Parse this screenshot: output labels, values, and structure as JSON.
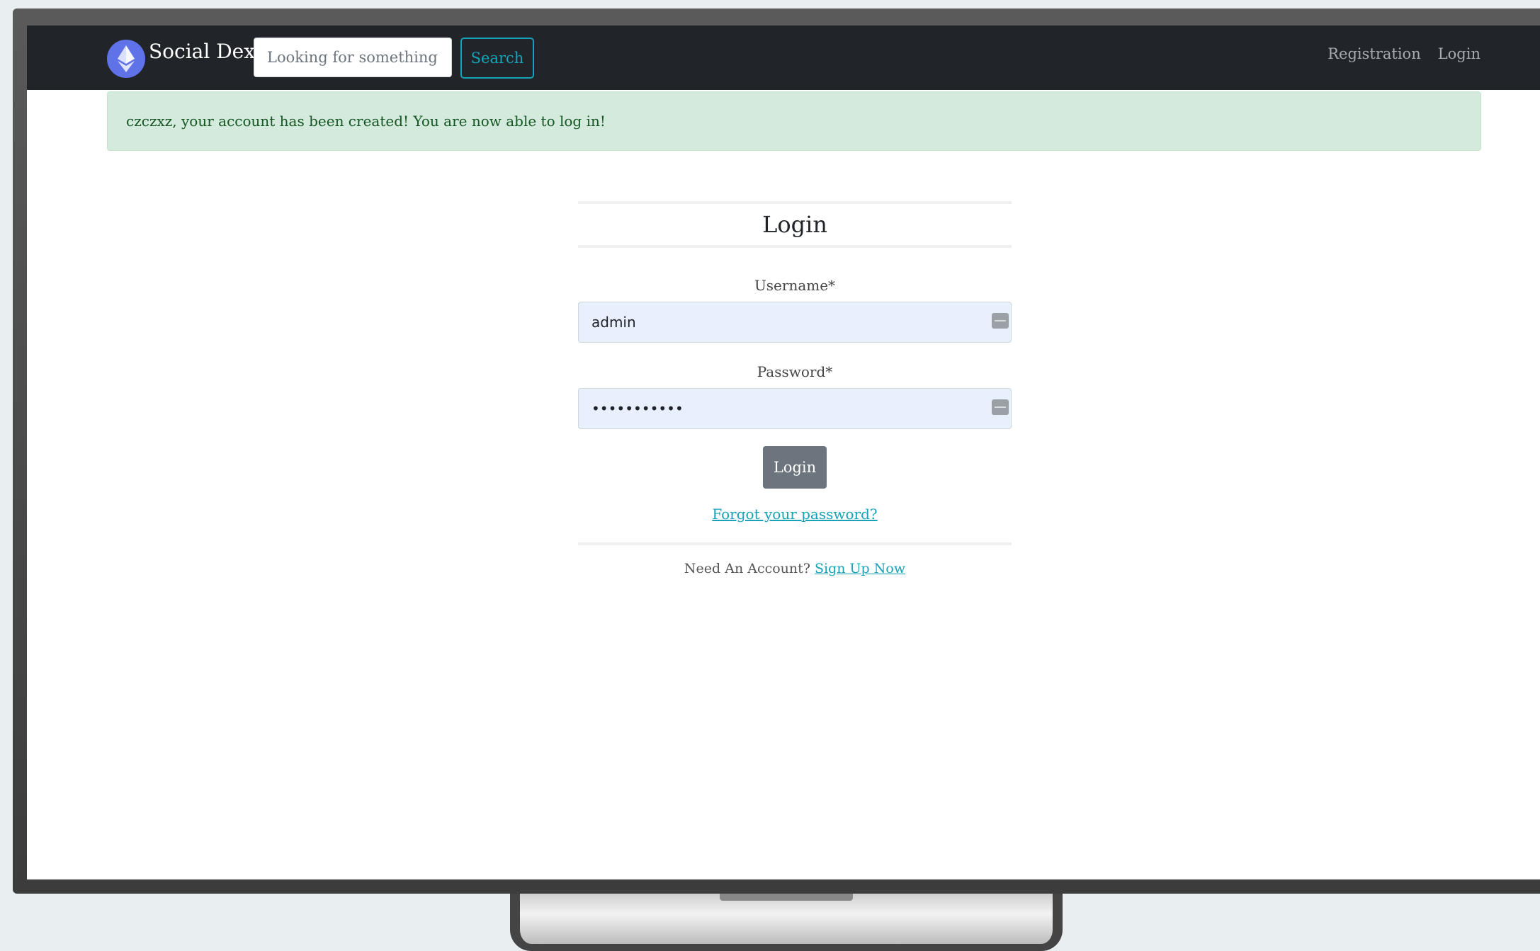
{
  "navbar": {
    "brand_name": "Social Dex",
    "search_placeholder": "Looking for something?",
    "search_label": "Search",
    "links": [
      "Registration",
      "Login"
    ]
  },
  "alert": {
    "message": "czczxz, your account has been created! You are now able to log in!"
  },
  "login_form": {
    "title": "Login",
    "username_label": "Username*",
    "username_value": "admin",
    "password_label": "Password*",
    "password_value": "•••••••••••",
    "submit_label": "Login",
    "forgot_link": "Forgot your password?",
    "signup_prompt": "Need An Account?",
    "signup_link": "Sign Up Now"
  },
  "colors": {
    "navbar_bg": "#212529",
    "accent": "#17a2b8",
    "alert_bg": "#d4eadc",
    "input_autofill_bg": "#e8f0fe",
    "button_secondary": "#6c757d"
  },
  "icons": [
    "ethereum-logo-icon",
    "autofill-key-icon"
  ]
}
